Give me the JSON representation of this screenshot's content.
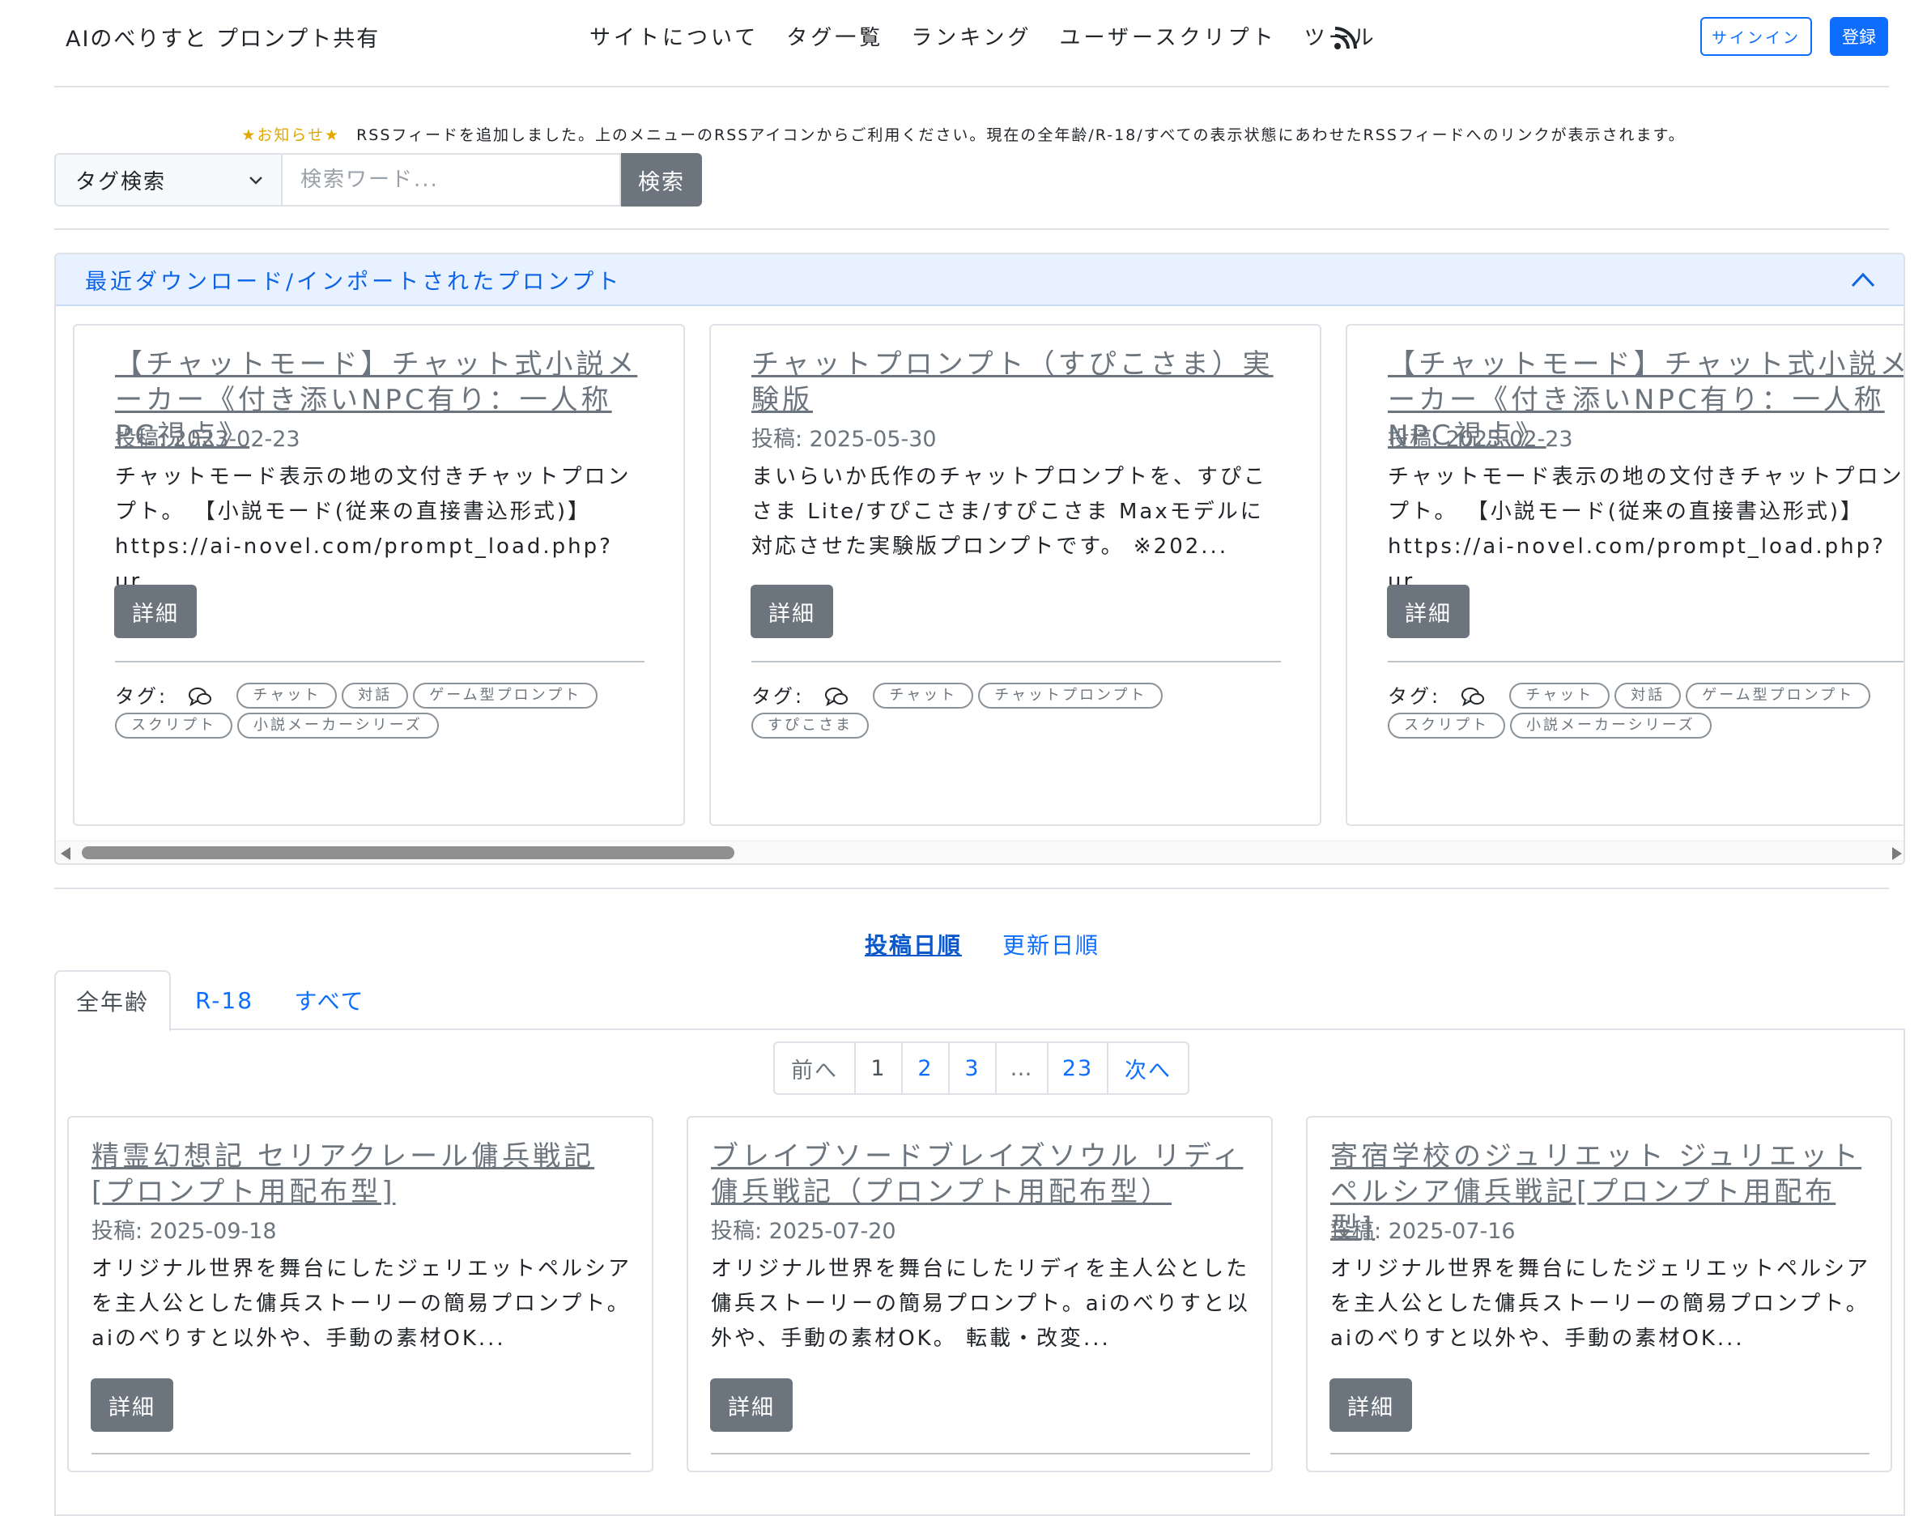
{
  "header": {
    "brand": "AIのべりすと プロンプト共有",
    "nav": [
      "サイトについて",
      "タグ一覧",
      "ランキング",
      "ユーザースクリプト",
      "ツール"
    ],
    "rss_icon": "rss-icon",
    "signin": "サインイン",
    "register": "登録"
  },
  "notice": {
    "label": "★お知らせ★",
    "text": "RSSフィードを追加しました。上のメニューのRSSアイコンからご利用ください。現在の全年齢/R-18/すべての表示状態にあわせたRSSフィードへのリンクが表示されます。"
  },
  "search": {
    "select_value": "タグ検索",
    "placeholder": "検索ワード...",
    "button": "検索"
  },
  "recent": {
    "title": "最近ダウンロード/インポートされたプロンプト",
    "cards": [
      {
        "title": "【チャットモード】チャット式小説メーカー《付き添いNPC有り：一人称PC視点》",
        "date": "投稿: 2023-02-23",
        "desc": "チャットモード表示の地の文付きチャットプロンプト。 【小説モード(従来の直接書込形式)】https://ai-novel.com/prompt_load.php?ur...",
        "button": "詳細",
        "tag_label": "タグ:",
        "tags": [
          "チャット",
          "対話",
          "ゲーム型プロンプト",
          "スクリプト",
          "小説メーカーシリーズ"
        ]
      },
      {
        "title": "チャットプロンプト（すぴこさま）実験版",
        "date": "投稿: 2025-05-30",
        "desc": "まいらいか氏作のチャットプロンプトを、すぴこさま Lite/すぴこさま/すぴこさま Maxモデルに対応させた実験版プロンプトです。 ※202...",
        "button": "詳細",
        "tag_label": "タグ:",
        "tags": [
          "チャット",
          "チャットプロンプト",
          "すぴこさま"
        ]
      },
      {
        "title": "【チャットモード】チャット式小説メーカー《付き添いNPC有り：一人称NPC視点》",
        "date": "投稿: 2023-02-23",
        "desc": "チャットモード表示の地の文付きチャットプロンプト。 【小説モード(従来の直接書込形式)】https://ai-novel.com/prompt_load.php?ur...",
        "button": "詳細",
        "tag_label": "タグ:",
        "tags": [
          "チャット",
          "対話",
          "ゲーム型プロンプト",
          "スクリプト",
          "小説メーカーシリーズ"
        ]
      }
    ]
  },
  "sort": {
    "by_posted": "投稿日順",
    "by_updated": "更新日順"
  },
  "tabs": [
    "全年齢",
    "R-18",
    "すべて"
  ],
  "pager": [
    "前へ",
    "1",
    "2",
    "3",
    "…",
    "23",
    "次へ"
  ],
  "list": [
    {
      "title": "精霊幻想記 セリアクレール傭兵戦記[プロンプト用配布型]",
      "date": "投稿: 2025-09-18",
      "desc": "オリジナル世界を舞台にしたジェリエットペルシアを主人公とした傭兵ストーリーの簡易プロンプト。aiのべりすと以外や、手動の素材OK...",
      "button": "詳細"
    },
    {
      "title": "ブレイブソードブレイズソウル リディ傭兵戦記（プロンプト用配布型）",
      "date": "投稿: 2025-07-20",
      "desc": "オリジナル世界を舞台にしたリディを主人公とした傭兵ストーリーの簡易プロンプト。aiのべりすと以外や、手動の素材OK。 転載・改変...",
      "button": "詳細"
    },
    {
      "title": "寄宿学校のジュリエット ジュリエットペルシア傭兵戦記[プロンプト用配布型]",
      "date": "投稿: 2025-07-16",
      "desc": "オリジナル世界を舞台にしたジェリエットペルシアを主人公とした傭兵ストーリーの簡易プロンプト。aiのべりすと以外や、手動の素材OK...",
      "button": "詳細"
    }
  ]
}
